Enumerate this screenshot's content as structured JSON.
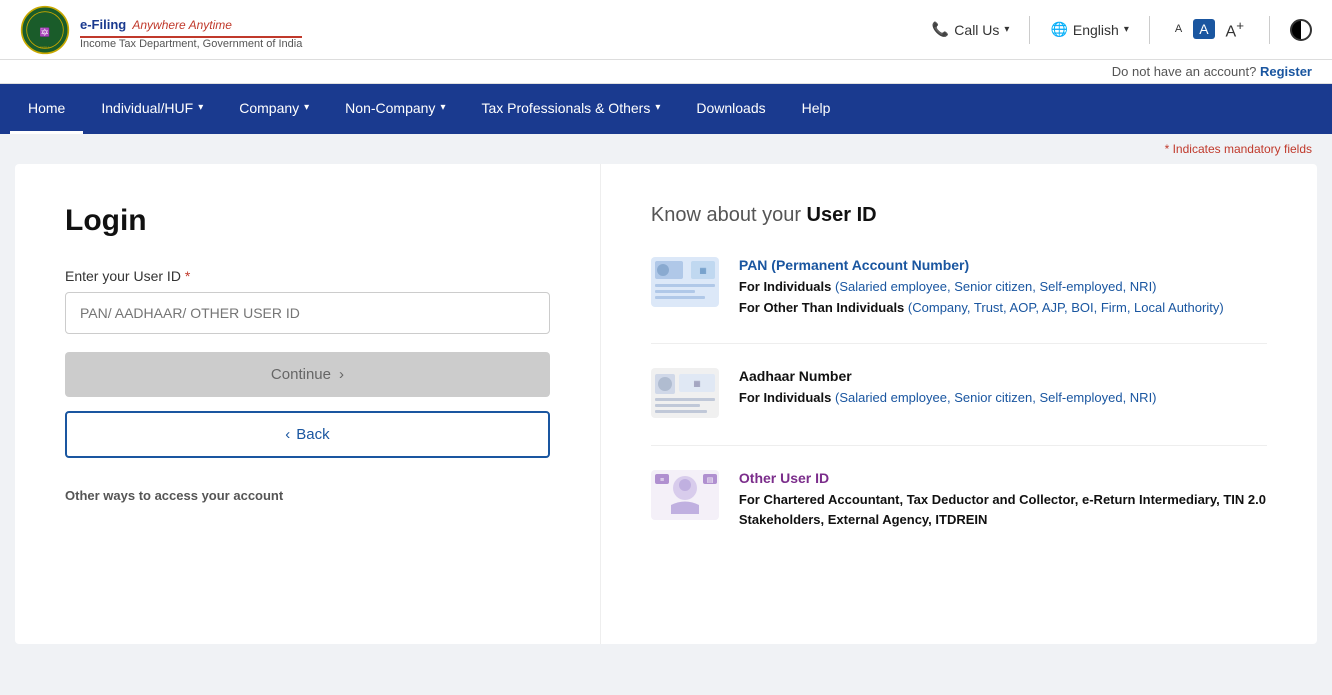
{
  "header": {
    "logo_title": "e-Filing",
    "logo_tagline": "Anywhere Anytime",
    "logo_subtitle": "Income Tax Department, Government of India",
    "call_us": "Call Us",
    "language": "English",
    "font_small": "A",
    "font_medium": "A",
    "font_large": "A+",
    "no_account_text": "Do not have an account?",
    "register_label": "Register"
  },
  "nav": {
    "items": [
      {
        "label": "Home",
        "active": true,
        "has_dropdown": false
      },
      {
        "label": "Individual/HUF",
        "active": false,
        "has_dropdown": true
      },
      {
        "label": "Company",
        "active": false,
        "has_dropdown": true
      },
      {
        "label": "Non-Company",
        "active": false,
        "has_dropdown": true
      },
      {
        "label": "Tax Professionals & Others",
        "active": false,
        "has_dropdown": true
      },
      {
        "label": "Downloads",
        "active": false,
        "has_dropdown": false
      },
      {
        "label": "Help",
        "active": false,
        "has_dropdown": false
      }
    ]
  },
  "mandatory_note": "* Indicates mandatory fields",
  "login": {
    "title": "Login",
    "field_label": "Enter your User ID",
    "field_placeholder": "PAN/ AADHAAR/ OTHER USER ID",
    "continue_label": "Continue",
    "back_label": "Back",
    "other_ways_label": "Other ways to access your account"
  },
  "know_userid": {
    "title_plain": "Know about your ",
    "title_bold": "User ID",
    "items": [
      {
        "id": "pan",
        "heading_plain": "PAN",
        "heading_blue": " (Permanent Account Number)",
        "line1_bold": "For Individuals",
        "line1_blue": " (Salaried employee, Senior citizen, Self-employed, NRI)",
        "line2_bold": "For Other Than Individuals",
        "line2_blue": " (Company, Trust, AOP, AJP, BOI, Firm, Local Authority)"
      },
      {
        "id": "aadhaar",
        "heading_plain": "Aadhaar Number",
        "heading_blue": "",
        "line1_bold": "For Individuals",
        "line1_blue": " (Salaried employee, Senior citizen, Self-employed, NRI)",
        "line2_bold": "",
        "line2_blue": ""
      },
      {
        "id": "other",
        "heading_plain": "Other User ID",
        "heading_blue": "",
        "heading_color": "purple",
        "line1_bold": "For Chartered Accountant, Tax Deductor and Collector, e-Return Intermediary, TIN 2.0 Stakeholders, External Agency, ITDREIN",
        "line1_blue": "",
        "line2_bold": "",
        "line2_blue": ""
      }
    ]
  }
}
